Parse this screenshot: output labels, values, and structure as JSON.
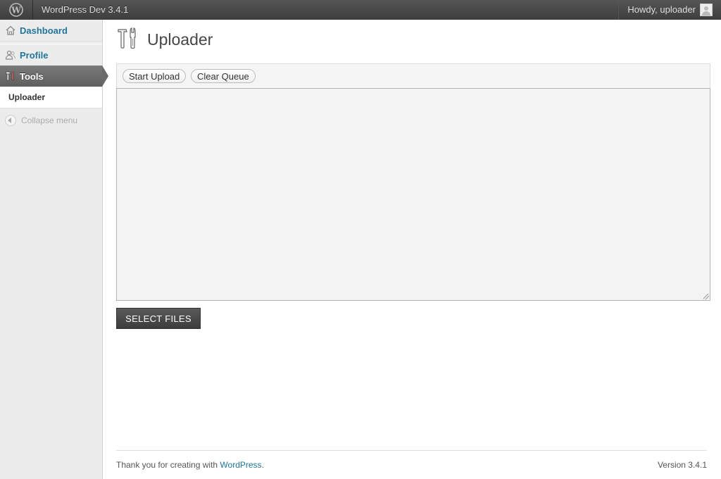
{
  "adminbar": {
    "logo_icon": "wordpress-logo-icon",
    "site_name": "WordPress Dev 3.4.1",
    "greeting": "Howdy, uploader",
    "avatar_icon": "user-avatar-icon"
  },
  "menu": {
    "dashboard": "Dashboard",
    "profile": "Profile",
    "tools": "Tools",
    "tools_submenu": [
      "Uploader"
    ],
    "collapse": "Collapse menu"
  },
  "page": {
    "title": "Uploader",
    "title_icon": "tools-icon"
  },
  "toolbar": {
    "start_upload": "Start Upload",
    "clear_queue": "Clear Queue"
  },
  "select_files": "SELECT FILES",
  "footer": {
    "thanks_prefix": "Thank you for creating with",
    "thanks_link": "WordPress",
    "thanks_suffix": ".",
    "version": "Version 3.4.1"
  },
  "colors": {
    "link": "#21759b",
    "adminbar": "#464646",
    "menu_bg": "#ececec",
    "active_menu": "#6d6d6d"
  }
}
